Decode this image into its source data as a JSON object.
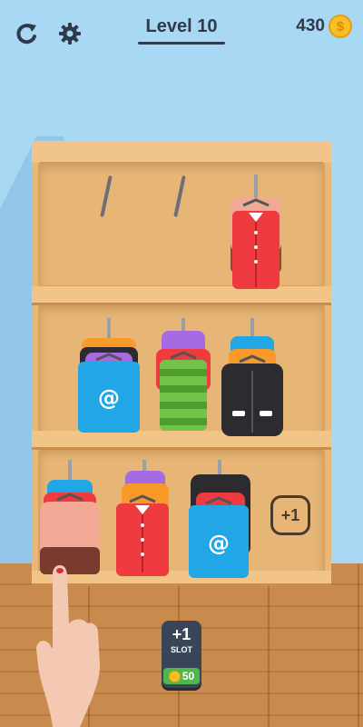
{
  "hud": {
    "restart_icon": "restart-icon",
    "settings_icon": "gear-icon",
    "level": "Level 10",
    "coins": "430",
    "coin_symbol": "$"
  },
  "cabinet": {
    "add_slot_label": "+1"
  },
  "slot_button": {
    "plus": "+1",
    "label": "SLOT",
    "price": "50"
  },
  "colors": {
    "background": "#a9d8f5",
    "wood": "#e7b676",
    "red": "#ef3b3f",
    "blue": "#21a7e5",
    "black": "#2b2b30",
    "peach": "#f2a995",
    "purple": "#a66be3",
    "orange": "#f79a2a",
    "green": "#73c24a"
  }
}
